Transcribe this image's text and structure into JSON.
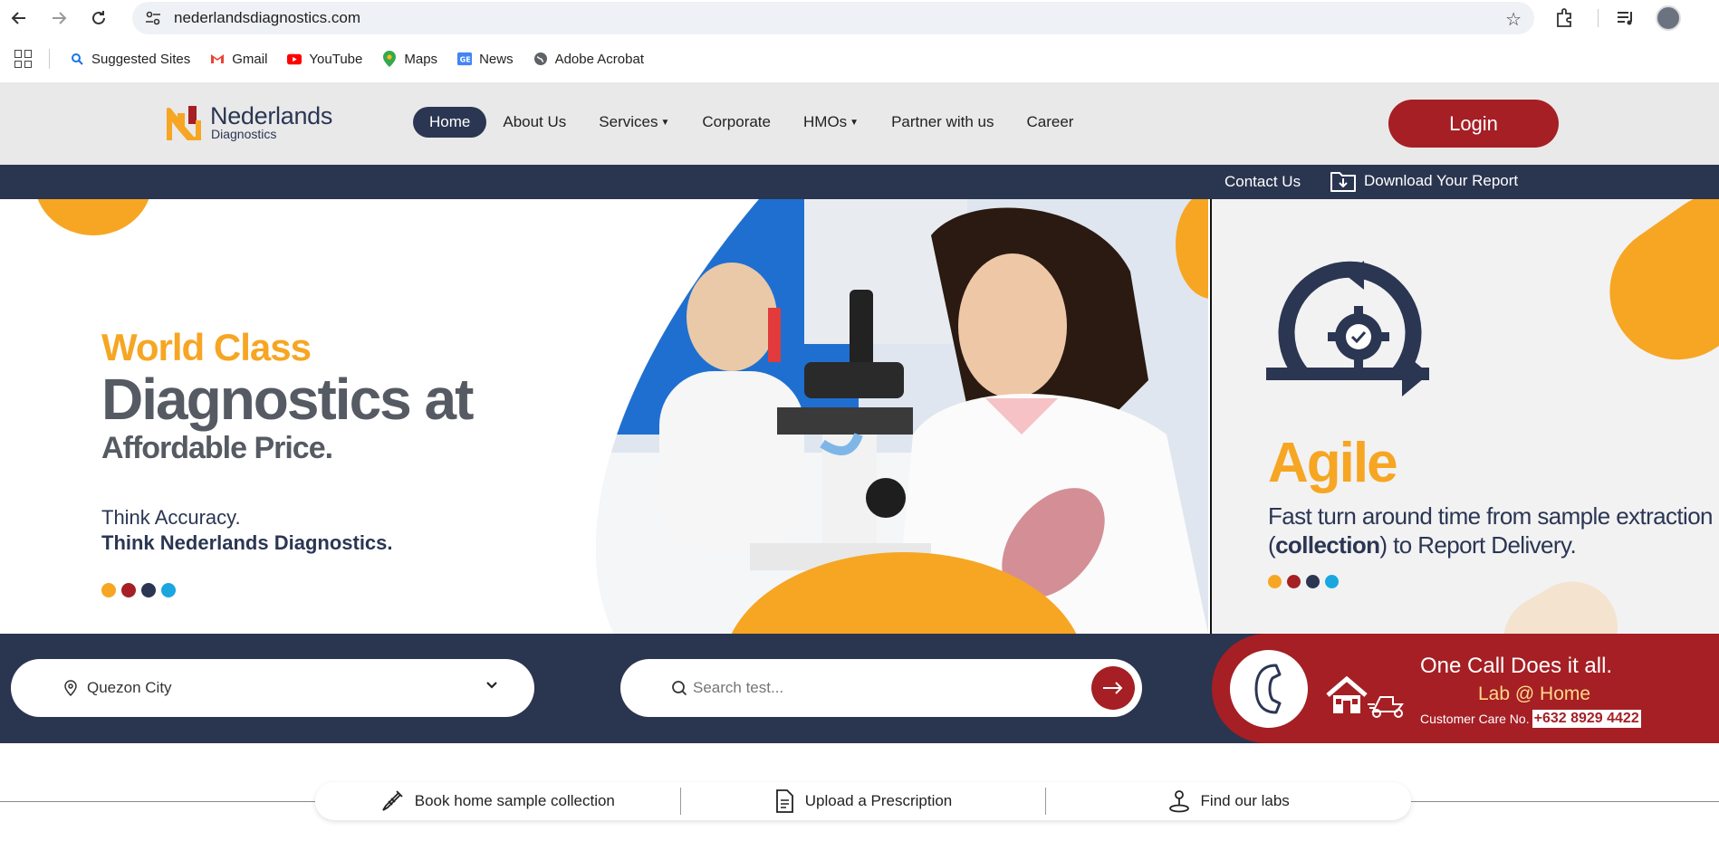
{
  "browser": {
    "url": "nederlandsdiagnostics.com",
    "bookmarks": [
      {
        "label": "Suggested Sites",
        "icon": "search-icon"
      },
      {
        "label": "Gmail",
        "icon": "gmail-icon"
      },
      {
        "label": "YouTube",
        "icon": "youtube-icon"
      },
      {
        "label": "Maps",
        "icon": "maps-icon"
      },
      {
        "label": "News",
        "icon": "news-icon"
      },
      {
        "label": "Adobe Acrobat",
        "icon": "globe-icon"
      }
    ]
  },
  "header": {
    "logo_name": "Nederlands",
    "logo_sub": "Diagnostics",
    "nav": {
      "home": "Home",
      "about": "About Us",
      "services": "Services",
      "corporate": "Corporate",
      "hmos": "HMOs",
      "partner": "Partner with us",
      "career": "Career"
    },
    "login": "Login"
  },
  "subbar": {
    "contact": "Contact Us",
    "download": "Download Your Report"
  },
  "hero": {
    "line1": "World Class",
    "line2": "Diagnostics at",
    "line3": "Affordable Price.",
    "line4": "Think Accuracy.",
    "line5": "Think Nederlands Diagnostics.",
    "dot_colors": [
      "#f6a623",
      "#a51f24",
      "#2b3653",
      "#1aa7e0"
    ]
  },
  "agile": {
    "title": "Agile",
    "desc_before": "Fast turn around time from sample extraction (",
    "desc_bold": "collection",
    "desc_after": ") to Report Delivery."
  },
  "search": {
    "location": "Quezon City",
    "placeholder": "Search test..."
  },
  "call": {
    "title": "One Call Does it all.",
    "subtitle": "Lab @ Home",
    "care_label": "Customer Care No.",
    "care_number": "+632 8929 4422"
  },
  "quick_actions": {
    "book": "Book home sample collection",
    "upload": "Upload a Prescription",
    "find": "Find our labs"
  },
  "colors": {
    "navy": "#2a3550",
    "red": "#a51f24",
    "orange": "#f6a623"
  }
}
